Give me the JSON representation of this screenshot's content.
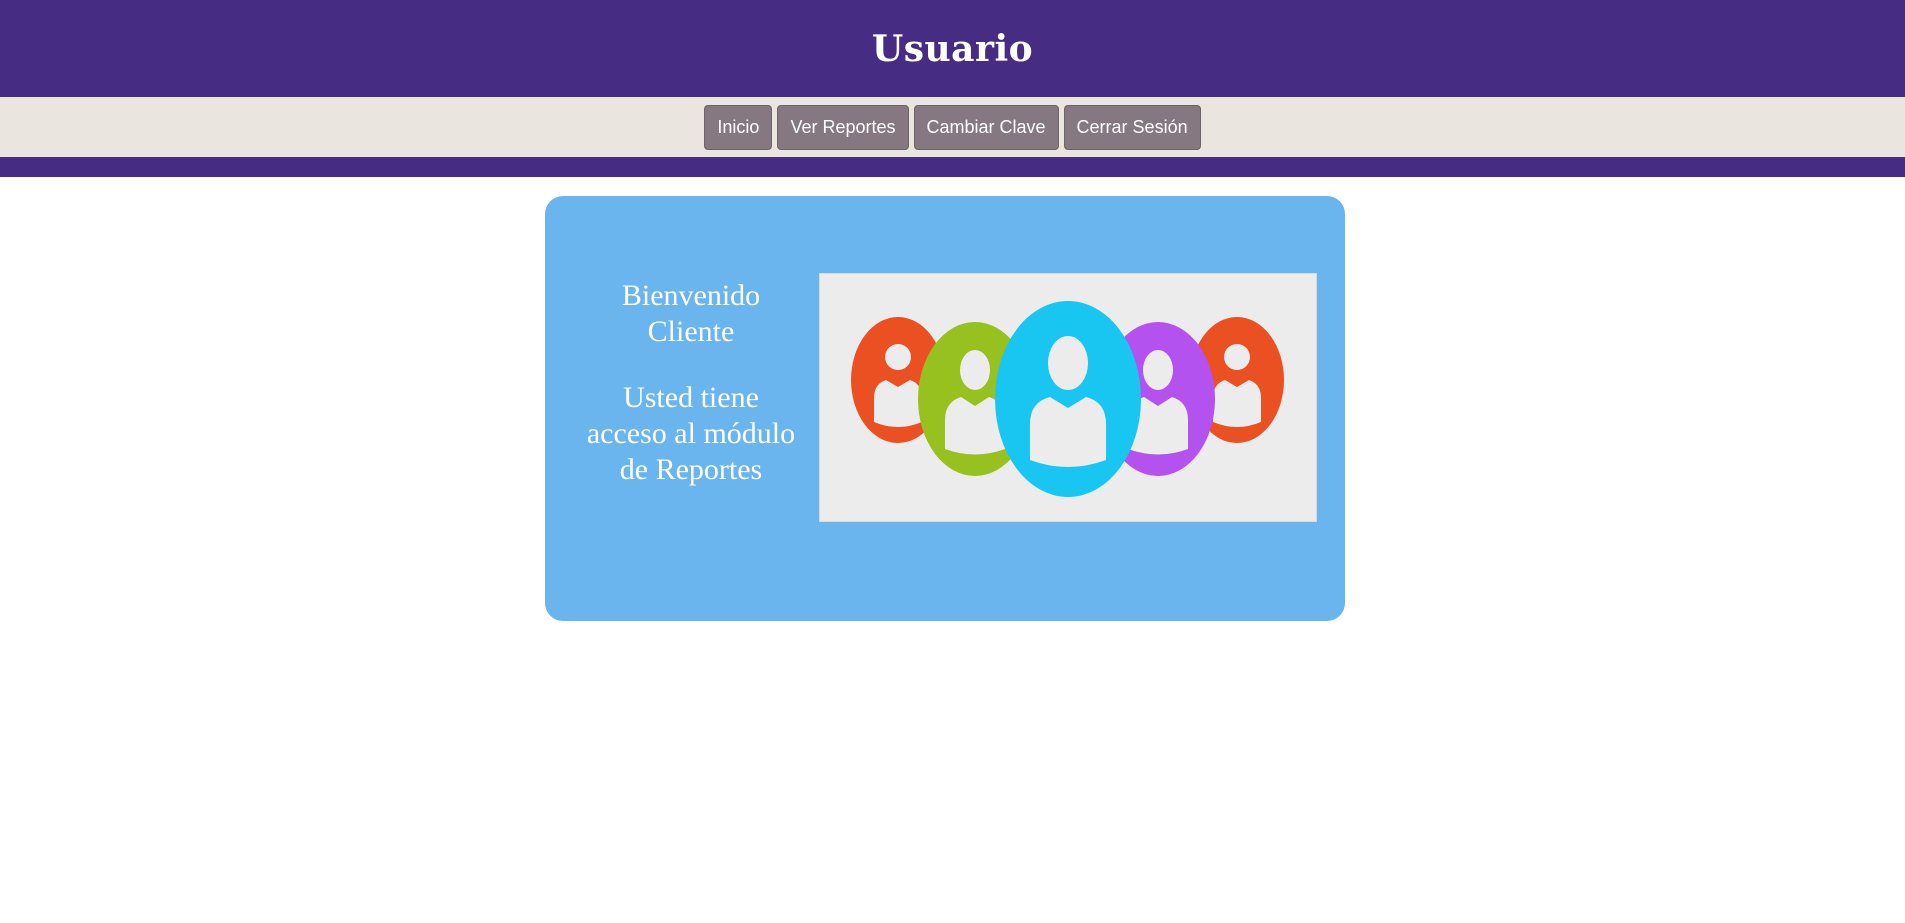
{
  "header": {
    "title": "Usuario"
  },
  "nav": {
    "items": [
      {
        "label": "Inicio"
      },
      {
        "label": "Ver Reportes"
      },
      {
        "label": "Cambiar Clave"
      },
      {
        "label": "Cerrar Sesión"
      }
    ]
  },
  "welcome": {
    "greeting": "Bienvenido Cliente",
    "message": "Usted tiene acceso al módulo de Reportes",
    "image_icon": "users-group-icon"
  },
  "colors": {
    "header": "#462c83",
    "nav_bar": "#eae5df",
    "nav_button": "#857880",
    "card": "#6bb5ee",
    "user_orange": "#ea5021",
    "user_green": "#96c11f",
    "user_cyan": "#19c6f2",
    "user_purple": "#b452ef"
  }
}
